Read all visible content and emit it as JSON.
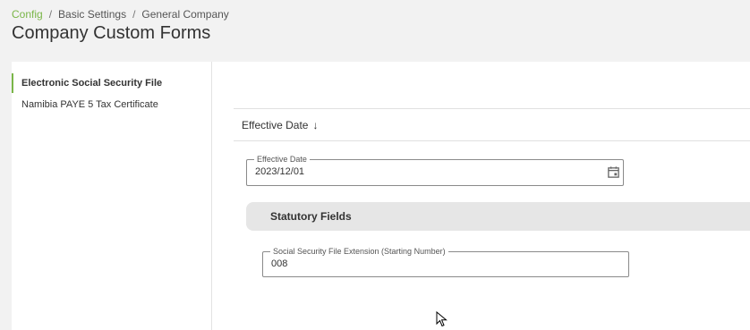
{
  "breadcrumb": {
    "items": [
      "Config",
      "Basic Settings",
      "General Company"
    ],
    "separator": "/"
  },
  "page": {
    "title": "Company Custom Forms"
  },
  "sidebar": {
    "items": [
      {
        "label": "Electronic Social Security File",
        "active": true
      },
      {
        "label": "Namibia PAYE 5 Tax Certificate",
        "active": false
      }
    ]
  },
  "main": {
    "effective_header": {
      "label": "Effective Date",
      "sort_icon": "arrow-down-icon"
    },
    "effective_date_field": {
      "label": "Effective Date",
      "value": "2023/12/01",
      "icon": "calendar-icon"
    },
    "statutory_section": {
      "title": "Statutory Fields"
    },
    "ss_extension_field": {
      "label": "Social Security File Extension (Starting Number)",
      "value": "008"
    }
  },
  "colors": {
    "accent": "#7ab648",
    "background": "#f2f2f2",
    "card": "#ffffff",
    "section": "#e6e6e6"
  }
}
